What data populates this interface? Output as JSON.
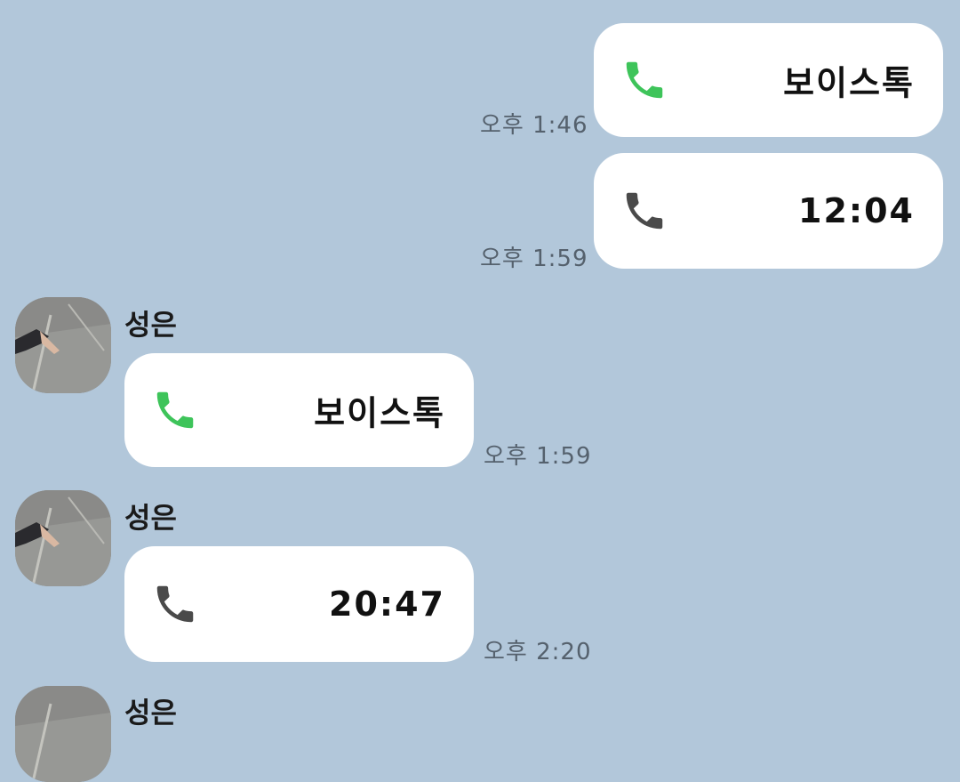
{
  "colors": {
    "background": "#b2c7da",
    "bubble": "#ffffff",
    "call_green": "#3ec45a",
    "call_gray": "#4a4a4a",
    "time_text": "#55616d"
  },
  "messages": [
    {
      "direction": "outgoing",
      "icon": "phone-green-icon",
      "text": "보이스톡",
      "time": "오후 1:46"
    },
    {
      "direction": "outgoing",
      "icon": "phone-gray-icon",
      "text": "12:04",
      "time": "오후 1:59"
    },
    {
      "direction": "incoming",
      "sender": "성은",
      "icon": "phone-green-icon",
      "text": "보이스톡",
      "time": "오후 1:59"
    },
    {
      "direction": "incoming",
      "sender": "성은",
      "icon": "phone-gray-icon",
      "text": "20:47",
      "time": "오후 2:20"
    },
    {
      "direction": "incoming",
      "sender": "성은"
    }
  ]
}
